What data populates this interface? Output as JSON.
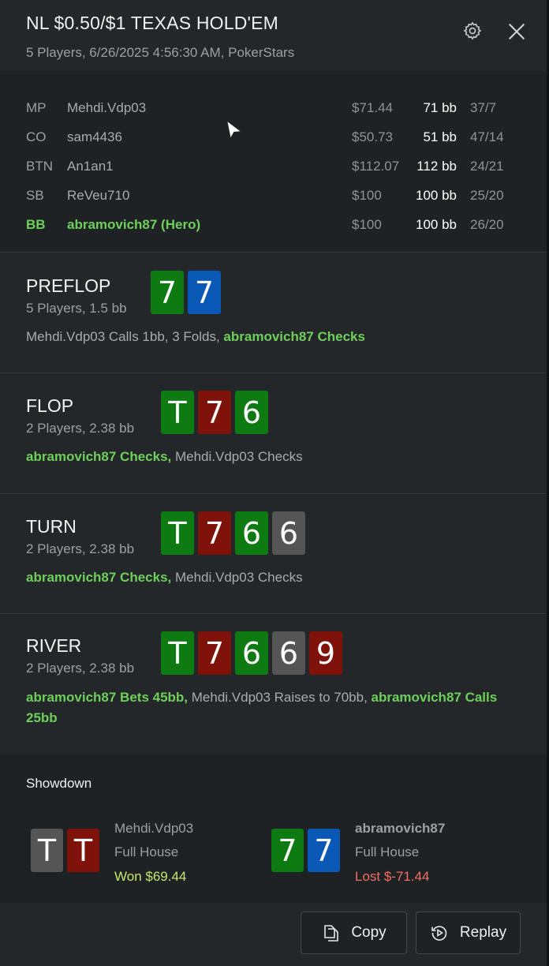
{
  "header": {
    "title": "NL $0.50/$1 TEXAS HOLD'EM",
    "subtitle": "5 Players, 6/26/2025 4:56:30 AM, PokerStars"
  },
  "players": [
    {
      "pos": "MP",
      "name": "Mehdi.Vdp03",
      "money": "$71.44",
      "bb": "71 bb",
      "stat": "37/7"
    },
    {
      "pos": "CO",
      "name": "sam4436",
      "money": "$50.73",
      "bb": "51 bb",
      "stat": "47/14"
    },
    {
      "pos": "BTN",
      "name": "An1an1",
      "money": "$112.07",
      "bb": "112 bb",
      "stat": "24/21"
    },
    {
      "pos": "SB",
      "name": "ReVeu710",
      "money": "$100",
      "bb": "100 bb",
      "stat": "25/20"
    },
    {
      "pos": "BB",
      "name": "abramovich87 (Hero)",
      "money": "$100",
      "bb": "100 bb",
      "stat": "26/20"
    }
  ],
  "streets": {
    "preflop": {
      "name": "PREFLOP",
      "info": "5 Players, 1.5 bb",
      "cards": [
        "7",
        "7"
      ],
      "action_a": "Mehdi.Vdp03 Calls 1bb, 3 Folds, ",
      "action_b": "abramovich87 Checks"
    },
    "flop": {
      "name": "FLOP",
      "info": "2 Players, 2.38 bb",
      "cards": [
        "T",
        "7",
        "6"
      ],
      "action_a": "abramovich87 Checks,",
      "action_b": " Mehdi.Vdp03 Checks"
    },
    "turn": {
      "name": "TURN",
      "info": "2 Players, 2.38 bb",
      "cards": [
        "T",
        "7",
        "6",
        "6"
      ],
      "action_a": "abramovich87 Checks,",
      "action_b": " Mehdi.Vdp03 Checks"
    },
    "river": {
      "name": "RIVER",
      "info": "2 Players, 2.38 bb",
      "cards": [
        "T",
        "7",
        "6",
        "6",
        "9"
      ],
      "action_a": "abramovich87 Bets 45bb,",
      "action_b": " Mehdi.Vdp03 Raises to 70bb, ",
      "action_c": "abramovich87 Calls 25bb"
    }
  },
  "showdown": {
    "title": "Showdown",
    "players": [
      {
        "cards": [
          "T",
          "T"
        ],
        "name": "Mehdi.Vdp03",
        "hand": "Full House",
        "result": "Won $69.44"
      },
      {
        "cards": [
          "7",
          "7"
        ],
        "name": "abramovich87",
        "hand": "Full House",
        "result": "Lost $-71.44"
      }
    ]
  },
  "footer": {
    "copy_label": "Copy",
    "replay_label": "Replay"
  },
  "colors": {
    "hero": "#6fcf5b",
    "card_green": "#0d7a12",
    "card_blue": "#0a58b5",
    "card_red": "#7f1209",
    "card_grey": "#555555",
    "won": "#c5e86c",
    "lost": "#f26e63"
  },
  "icons": [
    "gear-icon",
    "close-icon",
    "copy-icon",
    "replay-icon",
    "cursor-icon"
  ]
}
